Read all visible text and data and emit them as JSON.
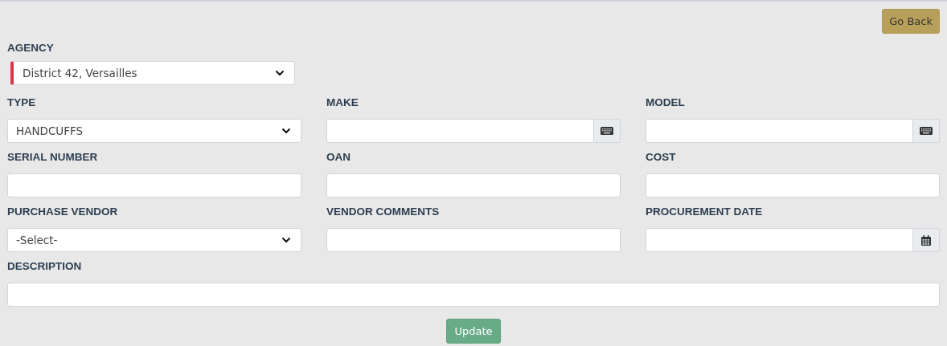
{
  "go_back": "Go Back",
  "agency": {
    "label": "AGENCY",
    "value": "District 42, Versailles",
    "required": true
  },
  "fields": [
    {
      "label": "TYPE",
      "kind": "select",
      "value": "HANDCUFFS"
    },
    {
      "label": "MAKE",
      "kind": "keyboard"
    },
    {
      "label": "MODEL",
      "kind": "keyboard"
    },
    {
      "label": "SERIAL NUMBER",
      "kind": "text"
    },
    {
      "label": "OAN",
      "kind": "text"
    },
    {
      "label": "COST",
      "kind": "text"
    },
    {
      "label": "PURCHASE VENDOR",
      "kind": "select",
      "value": "-Select-"
    },
    {
      "label": "VENDOR COMMENTS",
      "kind": "text"
    },
    {
      "label": "PROCUREMENT DATE",
      "kind": "date"
    }
  ],
  "description": {
    "label": "DESCRIPTION"
  },
  "update": "Update"
}
